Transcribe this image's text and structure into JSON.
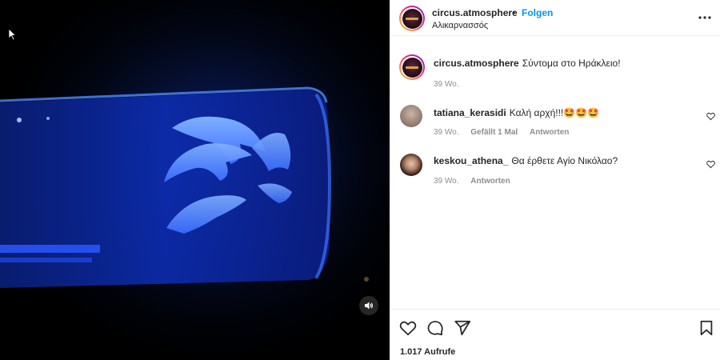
{
  "post": {
    "author": "circus.atmosphere",
    "separator": "•",
    "follow_label": "Folgen",
    "location": "Αλικαρνασσός",
    "caption": "Σύντομα στο Ηράκλειο!",
    "caption_age": "39 Wo."
  },
  "comments": [
    {
      "user": "tatiana_kerasidi",
      "text": "Καλή αρχή!!!🤩🤩🤩",
      "age": "39 Wo.",
      "likes": "Gefällt 1 Mal",
      "reply_label": "Antworten"
    },
    {
      "user": "keskou_athena_",
      "text": "Θα έρθετε Αγίο Νικόλαο?",
      "age": "39 Wo.",
      "reply_label": "Antworten"
    }
  ],
  "stats": {
    "views": "1.017 Aufrufe"
  },
  "icons": {
    "more": "more-options-icon",
    "like": "heart-icon",
    "comment": "comment-icon",
    "share": "share-icon",
    "save": "bookmark-icon",
    "mute": "speaker-icon"
  },
  "colors": {
    "accent": "#0095f6",
    "muted_text": "#8e8e8e",
    "aquarium_blue": "#1a5cff"
  }
}
